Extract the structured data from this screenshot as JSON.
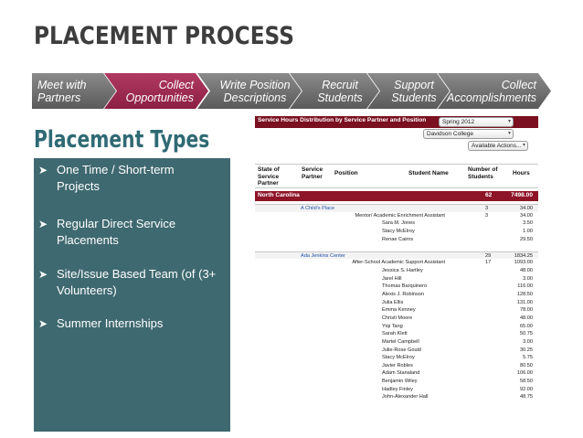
{
  "title": "PLACEMENT PROCESS",
  "process_steps": [
    {
      "line1": "Meet with",
      "line2": "Partners",
      "active": false
    },
    {
      "line1": "Collect",
      "line2": "Opportunities",
      "active": true
    },
    {
      "line1": "Write Position",
      "line2": "Descriptions",
      "active": false
    },
    {
      "line1": "Recruit",
      "line2": "Students",
      "active": false
    },
    {
      "line1": "Support",
      "line2": "Students",
      "active": false
    },
    {
      "line1": "Collect",
      "line2": "Accomplishments",
      "active": false
    }
  ],
  "section_title": "Placement Types",
  "bullets": [
    {
      "line1": "One Time / Short-term",
      "line2": "Projects"
    },
    {
      "line1": "Regular Direct Service",
      "line2": "Placements"
    },
    {
      "line1": "Site/Issue Based Team (of (3+",
      "line2": "Volunteers)"
    },
    {
      "line1": "Summer Internships",
      "line2": ""
    }
  ],
  "bullet_glyph": "➤",
  "report": {
    "header_title": "Service Hours Distribution by Service Partner and Position",
    "term_select": "Spring 2012",
    "college_select": "Davidson College",
    "actions_select": "Available Actions...",
    "columns": {
      "state": [
        "State of",
        "Service",
        "Partner"
      ],
      "partner": [
        "Service",
        "Partner"
      ],
      "position": "Position",
      "student": "Student Name",
      "count": [
        "Number of",
        "Students"
      ],
      "hours": "Hours"
    },
    "state_row": {
      "name": "North Carolina",
      "count": "62",
      "hours": "7498.00"
    },
    "rows": [
      {
        "type": "partner",
        "partner": "A Child's Place",
        "position": "",
        "name": "",
        "count": "3",
        "hours": "34.00"
      },
      {
        "type": "position",
        "partner": "",
        "position": "Mentor/ Academic Enrichment Assistant",
        "name": "",
        "count": "3",
        "hours": "34.00"
      },
      {
        "type": "student",
        "partner": "",
        "position": "",
        "name": "Sara M. Jones",
        "count": "",
        "hours": "3.50"
      },
      {
        "type": "student",
        "partner": "",
        "position": "",
        "name": "Stacy McElroy",
        "count": "",
        "hours": "1.00"
      },
      {
        "type": "student",
        "partner": "",
        "position": "",
        "name": "Renae Cairns",
        "count": "",
        "hours": "29.50"
      },
      {
        "type": "spacer",
        "partner": "",
        "position": "",
        "name": "",
        "count": "",
        "hours": ""
      },
      {
        "type": "partner",
        "partner": "Ada Jenkins Center",
        "position": "",
        "name": "",
        "count": "29",
        "hours": "1834.25"
      },
      {
        "type": "position",
        "partner": "",
        "position": "After-School Academic Support Assistant",
        "name": "",
        "count": "17",
        "hours": "1093.00"
      },
      {
        "type": "student",
        "partner": "",
        "position": "",
        "name": "Jessica S. Hartley",
        "count": "",
        "hours": "48.00"
      },
      {
        "type": "student",
        "partner": "",
        "position": "",
        "name": "Jarel Hill",
        "count": "",
        "hours": "3.00"
      },
      {
        "type": "student",
        "partner": "",
        "position": "",
        "name": "Thomas Barquinero",
        "count": "",
        "hours": "116.00"
      },
      {
        "type": "student",
        "partner": "",
        "position": "",
        "name": "Alexis J. Robinson",
        "count": "",
        "hours": "128.50"
      },
      {
        "type": "student",
        "partner": "",
        "position": "",
        "name": "Julia Ellis",
        "count": "",
        "hours": "131.00"
      },
      {
        "type": "student",
        "partner": "",
        "position": "",
        "name": "Emma Kenney",
        "count": "",
        "hours": "78.00"
      },
      {
        "type": "student",
        "partner": "",
        "position": "",
        "name": "Christi Moore",
        "count": "",
        "hours": "48.00"
      },
      {
        "type": "student",
        "partner": "",
        "position": "",
        "name": "Yiqi Tang",
        "count": "",
        "hours": "65.00"
      },
      {
        "type": "student",
        "partner": "",
        "position": "",
        "name": "Sarah Klett",
        "count": "",
        "hours": "50.75"
      },
      {
        "type": "student",
        "partner": "",
        "position": "",
        "name": "Martel Campbell",
        "count": "",
        "hours": "3.00"
      },
      {
        "type": "student",
        "partner": "",
        "position": "",
        "name": "Julie-Rose Gould",
        "count": "",
        "hours": "30.25"
      },
      {
        "type": "student",
        "partner": "",
        "position": "",
        "name": "Stacy McElroy",
        "count": "",
        "hours": "5.75"
      },
      {
        "type": "student",
        "partner": "",
        "position": "",
        "name": "Javier Robles",
        "count": "",
        "hours": "80.50"
      },
      {
        "type": "student",
        "partner": "",
        "position": "",
        "name": "Adam Stanaland",
        "count": "",
        "hours": "106.00"
      },
      {
        "type": "student",
        "partner": "",
        "position": "",
        "name": "Benjamin Wiley",
        "count": "",
        "hours": "58.50"
      },
      {
        "type": "student",
        "partner": "",
        "position": "",
        "name": "Hadley Finley",
        "count": "",
        "hours": "92.00"
      },
      {
        "type": "student",
        "partner": "",
        "position": "",
        "name": "John-Alexander Hall",
        "count": "",
        "hours": "48.75"
      }
    ]
  },
  "colors": {
    "step_gray": "#6f6f6f",
    "step_active": "#9e2a52",
    "section_title": "#2f6a74",
    "bullet_panel": "#3f6970",
    "report_header": "#7a1020",
    "state_row": "#8e1428",
    "partner_link": "#1f4fa8"
  }
}
